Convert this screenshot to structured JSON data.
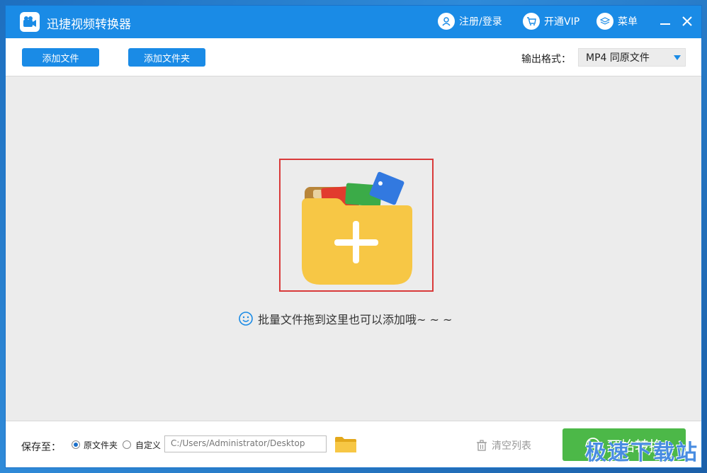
{
  "app": {
    "title": "迅捷视频转换器"
  },
  "titlebar": {
    "register_login": "注册/登录",
    "vip": "开通VIP",
    "menu": "菜单"
  },
  "toolbar": {
    "add_file": "添加文件",
    "add_folder": "添加文件夹",
    "format_label": "输出格式：",
    "format_value": "MP4  同原文件"
  },
  "main": {
    "hint": "批量文件拖到这里也可以添加哦~ ~ ~"
  },
  "bottom": {
    "save_to_label": "保存至：",
    "radio_original": "原文件夹",
    "radio_custom": "自定义",
    "path": "C:/Users/Administrator/Desktop",
    "clear_list": "清空列表",
    "start": "开始转换"
  },
  "watermark": "极速下载站",
  "colors": {
    "accent": "#1a8be6",
    "start_green": "#4cb848",
    "dropzone_border": "#d93a3a"
  }
}
